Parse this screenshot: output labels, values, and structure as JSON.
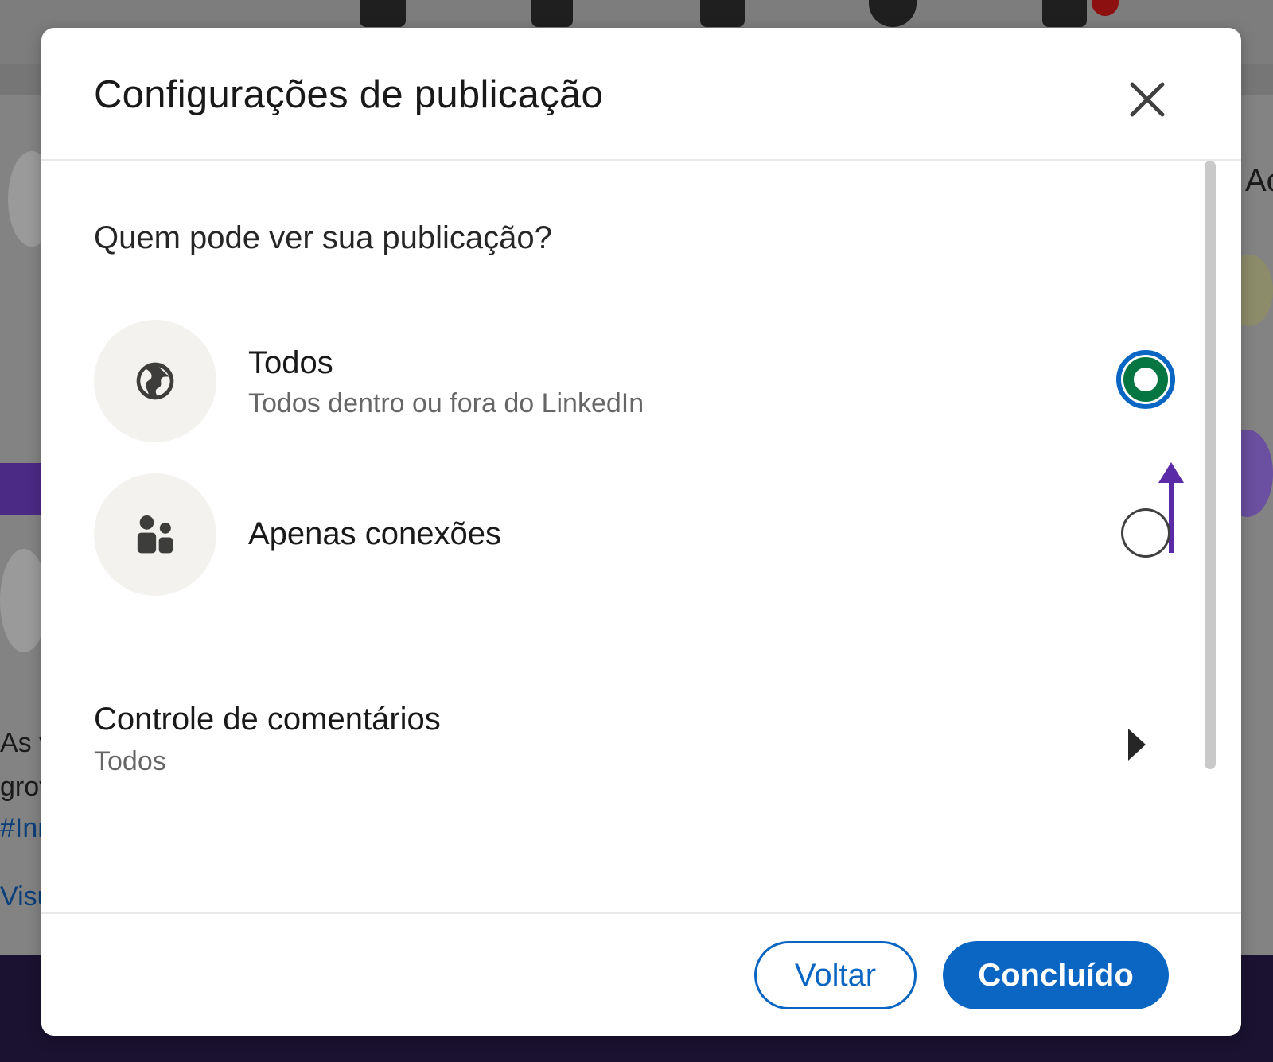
{
  "modal": {
    "title": "Configurações de publicação",
    "close_icon": "close-icon"
  },
  "visibility": {
    "question": "Quem pode ver sua publicação?",
    "options": [
      {
        "title": "Todos",
        "subtitle": "Todos dentro ou fora do LinkedIn",
        "icon": "globe-icon",
        "selected": true
      },
      {
        "title": "Apenas conexões",
        "subtitle": "",
        "icon": "people-icon",
        "selected": false
      }
    ]
  },
  "comments": {
    "title": "Controle de comentários",
    "value": "Todos",
    "icon": "chevron-right-icon"
  },
  "footer": {
    "back_label": "Voltar",
    "done_label": "Concluído"
  },
  "colors": {
    "brand_blue": "#0a66c2",
    "selected_green": "#057642",
    "annotation_purple": "#5b2aa6"
  },
  "background": {
    "left_fragments": [
      "As v",
      "grov",
      "#Inn",
      "Visu"
    ],
    "right_fragment": "Ac"
  }
}
